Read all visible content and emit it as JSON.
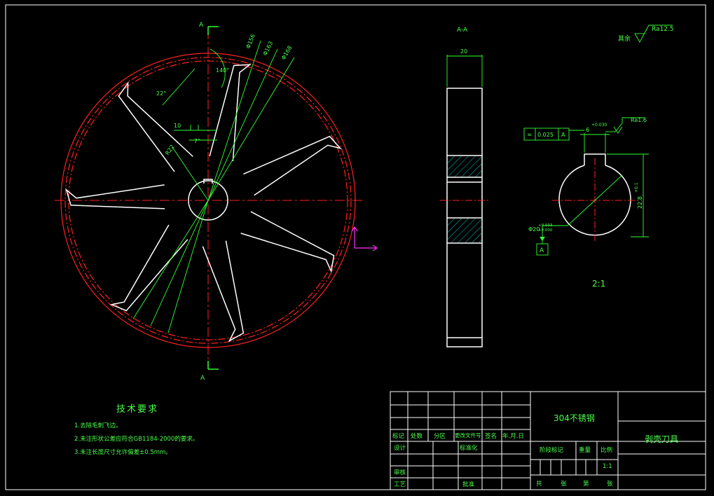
{
  "colors": {
    "background": "#000000",
    "outline": "#ffffff",
    "dimension": "#33ff33",
    "centerline": "#ff2020",
    "hatch": "#00c8c8",
    "ucs": "#ff30ff"
  },
  "icons": {
    "ucs": "ucs-axis-icon",
    "roughness": "surface-roughness-icon",
    "datum": "datum-marker-icon"
  },
  "main_view": {
    "section_mark_top": "A",
    "section_mark_bottom": "A",
    "diameters": [
      "Φ156",
      "Φ163",
      "Φ168"
    ],
    "angle_blade": "140°",
    "angle_tip": "22°",
    "angle_small": "7°",
    "dim_width": "10",
    "dim_radius": "R22"
  },
  "section_view": {
    "title": "A-A",
    "dim_width": "20"
  },
  "hub_detail": {
    "scale_label": "2:1",
    "keyway_width": "6",
    "keyway_tol": "+0.030",
    "height_dim": "22.8",
    "height_tol": "+0.1",
    "bore": "Φ20",
    "bore_tol_upper": "+0.033",
    "bore_tol_lower": "+0.000",
    "roughness": "Ra1.6",
    "geo_symbol": "=",
    "geo_value": "0.025",
    "datum": "A"
  },
  "roughness_other": {
    "label": "其余",
    "value": "Ra12.5"
  },
  "tech_requirements": {
    "title": "技术要求",
    "items": [
      "1.去除毛刺飞边。",
      "2.未注形状公差应符合GB1184-2000的要求。",
      "3.未注长度尺寸允许偏差±0.5mm。"
    ]
  },
  "title_block": {
    "material": "304不锈钢",
    "part_name": "剥壳刀具",
    "header_labels": [
      "标记",
      "处数",
      "分区",
      "更改文件号",
      "签名",
      "年.月.日"
    ],
    "design": "设计",
    "standardization": "标准化",
    "review": "审核",
    "process": "工艺",
    "approve": "批准",
    "stage_mark": "阶段标记",
    "weight": "重量",
    "ratio": "比例",
    "ratio_value": "1:1",
    "sheet_total": "共",
    "sheet_unit": "张",
    "sheet_num": "第",
    "sheet_unit2": "张"
  }
}
